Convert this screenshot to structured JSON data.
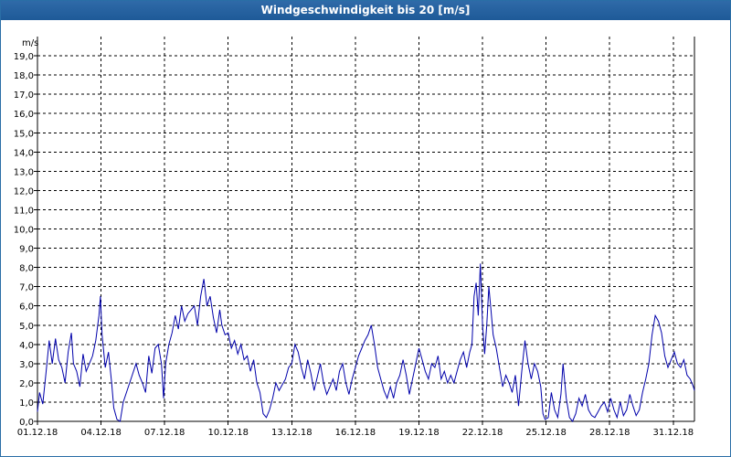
{
  "title": "Windgeschwindigkeit bis 20 [m/s]",
  "colors": {
    "titlebar": "#1e5a98",
    "line": "#0000aa",
    "grid": "#000000",
    "background": "#ffffff"
  },
  "chart_data": {
    "type": "line",
    "title": "Windgeschwindigkeit bis 20 [m/s]",
    "ylabel": "m/s",
    "ylim": [
      0,
      20
    ],
    "grid": true,
    "y_ticks": [
      "0,0",
      "1,0",
      "2,0",
      "3,0",
      "4,0",
      "5,0",
      "6,0",
      "7,0",
      "8,0",
      "9,0",
      "10,0",
      "11,0",
      "12,0",
      "13,0",
      "14,0",
      "15,0",
      "16,0",
      "17,0",
      "18,0",
      "19,0"
    ],
    "x_ticks": [
      {
        "day": 1,
        "label": "01.12.18"
      },
      {
        "day": 4,
        "label": "04.12.18"
      },
      {
        "day": 7,
        "label": "07.12.18"
      },
      {
        "day": 10,
        "label": "10.12.18"
      },
      {
        "day": 13,
        "label": "13.12.18"
      },
      {
        "day": 16,
        "label": "16.12.18"
      },
      {
        "day": 19,
        "label": "19.12.18"
      },
      {
        "day": 22,
        "label": "22.12.18"
      },
      {
        "day": 25,
        "label": "25.12.18"
      },
      {
        "day": 28,
        "label": "28.12.18"
      },
      {
        "day": 31,
        "label": "31.12.18"
      }
    ],
    "series": [
      {
        "color": "#0000aa",
        "points": [
          [
            1.0,
            0.5
          ],
          [
            1.1,
            1.5
          ],
          [
            1.25,
            0.9
          ],
          [
            1.4,
            2.5
          ],
          [
            1.55,
            4.2
          ],
          [
            1.7,
            3.0
          ],
          [
            1.85,
            4.3
          ],
          [
            2.0,
            3.2
          ],
          [
            2.15,
            2.8
          ],
          [
            2.3,
            2.0
          ],
          [
            2.45,
            3.6
          ],
          [
            2.6,
            4.6
          ],
          [
            2.7,
            3.0
          ],
          [
            2.85,
            2.6
          ],
          [
            3.0,
            1.8
          ],
          [
            3.15,
            3.5
          ],
          [
            3.3,
            2.6
          ],
          [
            3.45,
            3.0
          ],
          [
            3.6,
            3.4
          ],
          [
            3.75,
            4.2
          ],
          [
            3.9,
            5.5
          ],
          [
            3.97,
            6.5
          ],
          [
            4.05,
            4.5
          ],
          [
            4.2,
            2.8
          ],
          [
            4.35,
            3.6
          ],
          [
            4.5,
            2.0
          ],
          [
            4.6,
            0.7
          ],
          [
            4.75,
            0.1
          ],
          [
            4.9,
            0.0
          ],
          [
            5.05,
            1.0
          ],
          [
            5.2,
            1.5
          ],
          [
            5.35,
            2.0
          ],
          [
            5.5,
            2.5
          ],
          [
            5.65,
            3.0
          ],
          [
            5.8,
            2.4
          ],
          [
            5.95,
            2.0
          ],
          [
            6.1,
            1.5
          ],
          [
            6.25,
            3.4
          ],
          [
            6.4,
            2.5
          ],
          [
            6.55,
            3.8
          ],
          [
            6.7,
            4.0
          ],
          [
            6.85,
            3.0
          ],
          [
            6.95,
            1.2
          ],
          [
            7.05,
            3.0
          ],
          [
            7.2,
            4.0
          ],
          [
            7.35,
            4.6
          ],
          [
            7.5,
            5.5
          ],
          [
            7.65,
            4.8
          ],
          [
            7.8,
            6.0
          ],
          [
            7.95,
            5.2
          ],
          [
            8.1,
            5.6
          ],
          [
            8.25,
            5.8
          ],
          [
            8.4,
            6.0
          ],
          [
            8.55,
            5.0
          ],
          [
            8.7,
            6.5
          ],
          [
            8.85,
            7.4
          ],
          [
            9.0,
            6.0
          ],
          [
            9.15,
            6.5
          ],
          [
            9.3,
            5.4
          ],
          [
            9.45,
            4.6
          ],
          [
            9.6,
            5.8
          ],
          [
            9.7,
            5.0
          ],
          [
            9.85,
            4.5
          ],
          [
            10.0,
            4.6
          ],
          [
            10.15,
            3.8
          ],
          [
            10.3,
            4.2
          ],
          [
            10.45,
            3.5
          ],
          [
            10.6,
            4.0
          ],
          [
            10.75,
            3.2
          ],
          [
            10.9,
            3.4
          ],
          [
            11.05,
            2.6
          ],
          [
            11.2,
            3.2
          ],
          [
            11.35,
            2.0
          ],
          [
            11.5,
            1.5
          ],
          [
            11.65,
            0.4
          ],
          [
            11.8,
            0.2
          ],
          [
            11.95,
            0.6
          ],
          [
            12.1,
            1.2
          ],
          [
            12.25,
            2.0
          ],
          [
            12.4,
            1.6
          ],
          [
            12.55,
            1.9
          ],
          [
            12.7,
            2.2
          ],
          [
            12.85,
            2.8
          ],
          [
            13.0,
            3.0
          ],
          [
            13.15,
            4.0
          ],
          [
            13.3,
            3.6
          ],
          [
            13.45,
            2.8
          ],
          [
            13.6,
            2.2
          ],
          [
            13.75,
            3.2
          ],
          [
            13.9,
            2.5
          ],
          [
            14.05,
            1.6
          ],
          [
            14.2,
            2.3
          ],
          [
            14.35,
            3.0
          ],
          [
            14.5,
            2.0
          ],
          [
            14.65,
            1.4
          ],
          [
            14.8,
            1.8
          ],
          [
            14.95,
            2.2
          ],
          [
            15.1,
            1.6
          ],
          [
            15.25,
            2.6
          ],
          [
            15.4,
            3.0
          ],
          [
            15.55,
            2.0
          ],
          [
            15.7,
            1.4
          ],
          [
            15.85,
            2.2
          ],
          [
            16.0,
            2.8
          ],
          [
            16.15,
            3.4
          ],
          [
            16.3,
            3.8
          ],
          [
            16.45,
            4.2
          ],
          [
            16.6,
            4.5
          ],
          [
            16.75,
            5.0
          ],
          [
            16.9,
            4.0
          ],
          [
            17.05,
            2.8
          ],
          [
            17.2,
            2.2
          ],
          [
            17.35,
            1.6
          ],
          [
            17.5,
            1.2
          ],
          [
            17.65,
            1.8
          ],
          [
            17.8,
            1.2
          ],
          [
            17.95,
            2.0
          ],
          [
            18.1,
            2.4
          ],
          [
            18.25,
            3.2
          ],
          [
            18.4,
            2.4
          ],
          [
            18.55,
            1.4
          ],
          [
            18.7,
            2.2
          ],
          [
            18.85,
            3.0
          ],
          [
            19.0,
            3.8
          ],
          [
            19.15,
            3.2
          ],
          [
            19.3,
            2.6
          ],
          [
            19.45,
            2.2
          ],
          [
            19.6,
            3.0
          ],
          [
            19.75,
            2.8
          ],
          [
            19.9,
            3.4
          ],
          [
            20.05,
            2.2
          ],
          [
            20.2,
            2.6
          ],
          [
            20.35,
            2.0
          ],
          [
            20.5,
            2.4
          ],
          [
            20.65,
            2.0
          ],
          [
            20.8,
            2.6
          ],
          [
            20.95,
            3.2
          ],
          [
            21.1,
            3.6
          ],
          [
            21.25,
            2.8
          ],
          [
            21.4,
            3.6
          ],
          [
            21.5,
            4.0
          ],
          [
            21.6,
            6.5
          ],
          [
            21.7,
            7.2
          ],
          [
            21.8,
            5.5
          ],
          [
            21.9,
            8.2
          ],
          [
            22.0,
            5.0
          ],
          [
            22.1,
            3.5
          ],
          [
            22.2,
            5.0
          ],
          [
            22.3,
            7.0
          ],
          [
            22.4,
            5.8
          ],
          [
            22.5,
            4.5
          ],
          [
            22.65,
            3.8
          ],
          [
            22.8,
            2.8
          ],
          [
            22.95,
            1.8
          ],
          [
            23.1,
            2.4
          ],
          [
            23.25,
            2.0
          ],
          [
            23.4,
            1.5
          ],
          [
            23.55,
            2.4
          ],
          [
            23.7,
            0.8
          ],
          [
            23.85,
            2.6
          ],
          [
            24.0,
            4.2
          ],
          [
            24.15,
            3.0
          ],
          [
            24.3,
            2.2
          ],
          [
            24.45,
            3.0
          ],
          [
            24.6,
            2.6
          ],
          [
            24.75,
            1.8
          ],
          [
            24.85,
            0.4
          ],
          [
            24.95,
            0.1
          ],
          [
            25.1,
            0.2
          ],
          [
            25.25,
            1.5
          ],
          [
            25.4,
            0.6
          ],
          [
            25.55,
            0.2
          ],
          [
            25.7,
            1.4
          ],
          [
            25.8,
            3.0
          ],
          [
            25.95,
            1.2
          ],
          [
            26.1,
            0.2
          ],
          [
            26.25,
            0.0
          ],
          [
            26.4,
            0.4
          ],
          [
            26.55,
            1.2
          ],
          [
            26.7,
            0.8
          ],
          [
            26.85,
            1.4
          ],
          [
            27.0,
            0.6
          ],
          [
            27.15,
            0.3
          ],
          [
            27.3,
            0.2
          ],
          [
            27.45,
            0.5
          ],
          [
            27.6,
            0.8
          ],
          [
            27.75,
            1.0
          ],
          [
            27.9,
            0.5
          ],
          [
            28.05,
            1.2
          ],
          [
            28.2,
            0.6
          ],
          [
            28.35,
            0.2
          ],
          [
            28.5,
            1.0
          ],
          [
            28.65,
            0.3
          ],
          [
            28.8,
            0.6
          ],
          [
            28.95,
            1.4
          ],
          [
            29.1,
            0.8
          ],
          [
            29.25,
            0.3
          ],
          [
            29.4,
            0.6
          ],
          [
            29.55,
            1.5
          ],
          [
            29.7,
            2.2
          ],
          [
            29.85,
            3.0
          ],
          [
            30.0,
            4.5
          ],
          [
            30.15,
            5.5
          ],
          [
            30.3,
            5.2
          ],
          [
            30.45,
            4.6
          ],
          [
            30.6,
            3.4
          ],
          [
            30.75,
            2.8
          ],
          [
            30.9,
            3.2
          ],
          [
            31.05,
            3.6
          ],
          [
            31.2,
            3.0
          ],
          [
            31.35,
            2.8
          ],
          [
            31.5,
            3.2
          ],
          [
            31.65,
            2.4
          ],
          [
            31.8,
            2.2
          ],
          [
            31.95,
            1.8
          ],
          [
            32.0,
            1.6
          ]
        ]
      }
    ]
  }
}
